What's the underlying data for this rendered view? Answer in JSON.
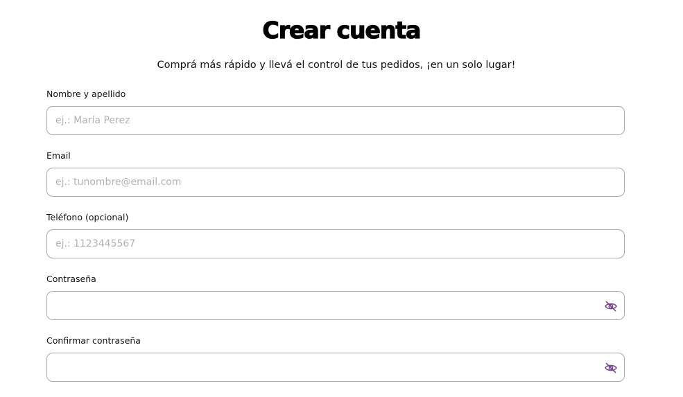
{
  "header": {
    "title": "Crear cuenta",
    "subtitle": "Comprá más rápido y llevá el control de tus pedidos, ¡en un solo lugar!"
  },
  "form": {
    "name": {
      "label": "Nombre y apellido",
      "placeholder": "ej.: María Perez",
      "value": ""
    },
    "email": {
      "label": "Email",
      "placeholder": "ej.: tunombre@email.com",
      "value": ""
    },
    "phone": {
      "label": "Teléfono (opcional)",
      "placeholder": "ej.: 1123445567",
      "value": ""
    },
    "password": {
      "label": "Contraseña",
      "placeholder": "",
      "value": "",
      "toggle_icon": "eye-slash-icon"
    },
    "confirm_password": {
      "label": "Confirmar contraseña",
      "placeholder": "",
      "value": "",
      "toggle_icon": "eye-slash-icon"
    }
  },
  "colors": {
    "icon_accent": "#7b4a8f",
    "input_border": "#a9a9a9",
    "placeholder": "#b3b3b3"
  }
}
